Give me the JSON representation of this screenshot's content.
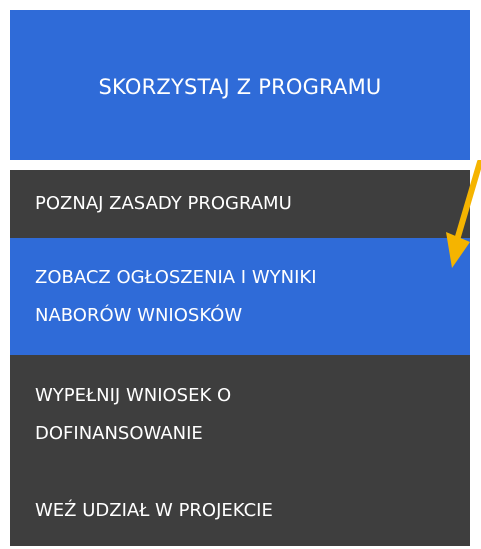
{
  "menu": {
    "header_title": "SKORZYSTAJ Z PROGRAMU",
    "items": [
      {
        "label": "POZNAJ ZASADY PROGRAMU"
      },
      {
        "label": "ZOBACZ OGŁOSZENIA I WYNIKI NABORÓW WNIOSKÓW"
      },
      {
        "label": "WYPEŁNIJ WNIOSEK O DOFINANSOWANIE"
      },
      {
        "label": "WEŹ UDZIAŁ W PROJEKCIE"
      }
    ]
  },
  "colors": {
    "header_bg": "#2f6bd8",
    "active_item_bg": "#2f6bd8",
    "item_bg": "#3e3e3e",
    "text": "#ffffff",
    "arrow": "#f5b400"
  },
  "icons": {
    "pointer": "arrow-pointer-icon"
  }
}
